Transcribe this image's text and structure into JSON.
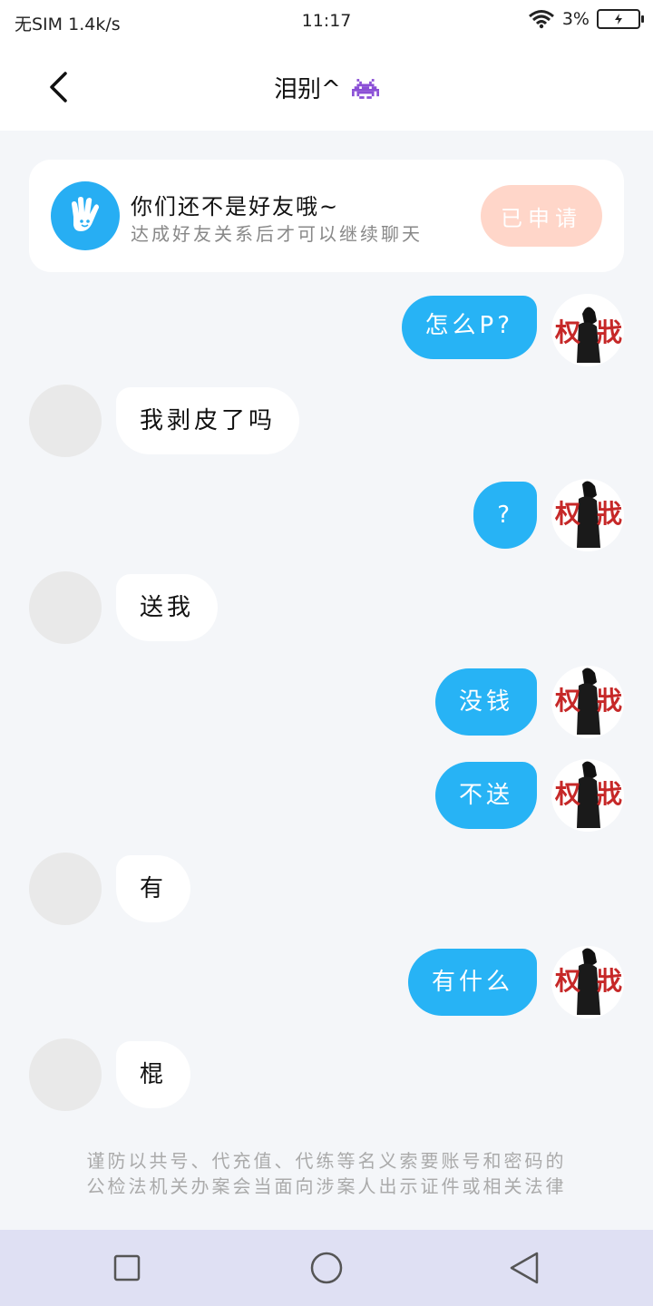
{
  "status_bar": {
    "carrier": "无SIM",
    "speed": "1.4k/s",
    "time": "11:17",
    "battery_percent": "3%",
    "wifi_icon": "wifi-icon",
    "battery_icon": "battery-charging-icon"
  },
  "header": {
    "title": "泪别^",
    "title_emoji_icon": "space-invader-icon",
    "back_icon": "chevron-left-icon"
  },
  "friend_card": {
    "title": "你们还不是好友哦~",
    "subtitle": "达成好友关系后才可以继续聊天",
    "button_label": "已申请",
    "icon": "waving-hand-icon"
  },
  "messages": [
    {
      "side": "me",
      "text": "怎么P?"
    },
    {
      "side": "other",
      "text": "我剥皮了吗"
    },
    {
      "side": "me",
      "text": "?"
    },
    {
      "side": "other",
      "text": "送我"
    },
    {
      "side": "me",
      "text": "没钱"
    },
    {
      "side": "me",
      "text": "不送"
    },
    {
      "side": "other",
      "text": "有"
    },
    {
      "side": "me",
      "text": "有什么"
    },
    {
      "side": "other",
      "text": "棍"
    }
  ],
  "warning": {
    "line1": "谨防以共号、代充值、代练等名义索要账号和密码的",
    "line2": "公检法机关办案会当面向涉案人出示证件或相关法律"
  },
  "nav_bar": {
    "recents_icon": "square-icon",
    "home_icon": "circle-icon",
    "back_icon": "triangle-back-icon"
  },
  "colors": {
    "accent_blue": "#27b3f5",
    "applied_button": "#ffd6c9",
    "background": "#f4f6f9"
  }
}
